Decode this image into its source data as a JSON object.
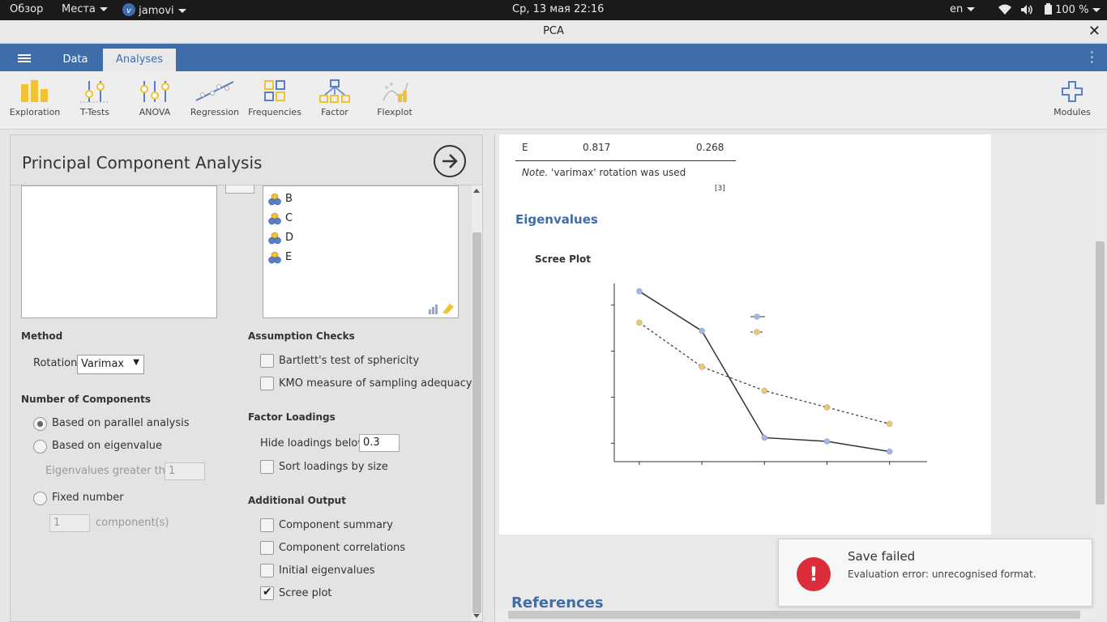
{
  "topbar": {
    "overview": "Обзор",
    "places": "Места",
    "app": "jamovi",
    "datetime": "Ср, 13 мая  22:16",
    "lang": "en",
    "battery": "100 %"
  },
  "window": {
    "title": "PCA",
    "close": "✕"
  },
  "nav": {
    "tabs": [
      {
        "label": "Data"
      },
      {
        "label": "Analyses"
      }
    ]
  },
  "ribbon": {
    "items": [
      {
        "label": "Exploration"
      },
      {
        "label": "T-Tests"
      },
      {
        "label": "ANOVA"
      },
      {
        "label": "Regression"
      },
      {
        "label": "Frequencies"
      },
      {
        "label": "Factor"
      },
      {
        "label": "Flexplot"
      }
    ],
    "modules": "Modules"
  },
  "panel": {
    "title": "Principal Component Analysis",
    "variables": [
      "B",
      "C",
      "D",
      "E"
    ],
    "method": {
      "heading": "Method",
      "rotation_label": "Rotation",
      "rotation_value": "Varimax"
    },
    "components": {
      "heading": "Number of Components",
      "parallel": "Based on parallel analysis",
      "eigenvalue": "Based on eigenvalue",
      "eigen_greater": "Eigenvalues greater than",
      "eigen_value": "1",
      "fixed": "Fixed number",
      "fixed_value": "1",
      "fixed_unit": "component(s)"
    },
    "assumption": {
      "heading": "Assumption Checks",
      "bartlett": "Bartlett's test of sphericity",
      "kmo": "KMO measure of sampling adequacy"
    },
    "loadings": {
      "heading": "Factor Loadings",
      "hide_label": "Hide loadings below",
      "hide_value": "0.3",
      "sort": "Sort loadings by size"
    },
    "additional": {
      "heading": "Additional Output",
      "summary": "Component summary",
      "correlations": "Component correlations",
      "initial": "Initial eigenvalues",
      "scree": "Scree plot"
    }
  },
  "results": {
    "row_e": {
      "label": "E",
      "v1": "0.817",
      "v2": "0.268"
    },
    "note_prefix": "Note.",
    "note_text": " 'varimax' rotation was used",
    "ref_marker": "[3]",
    "eigen_heading": "Eigenvalues",
    "plot_title": "Scree Plot",
    "references_heading": "References"
  },
  "chart_data": {
    "type": "line",
    "title": "Scree Plot",
    "x": [
      1,
      2,
      3,
      4,
      5
    ],
    "series": [
      {
        "values": [
          1.65,
          1.22,
          0.06,
          0.02,
          -0.09
        ],
        "color": "#a3b4e8",
        "linestyle": "solid"
      },
      {
        "values": [
          1.31,
          0.83,
          0.57,
          0.39,
          0.21
        ],
        "color": "#edc96a",
        "linestyle": "dashed"
      }
    ],
    "ylim": [
      -0.2,
      1.7
    ],
    "legend": "top-right",
    "grid": false
  },
  "toast": {
    "title": "Save failed",
    "message": "Evaluation error: unrecognised format.",
    "icon": "!"
  },
  "colors": {
    "accent": "#3e6da9",
    "error": "#dc2d3a"
  }
}
